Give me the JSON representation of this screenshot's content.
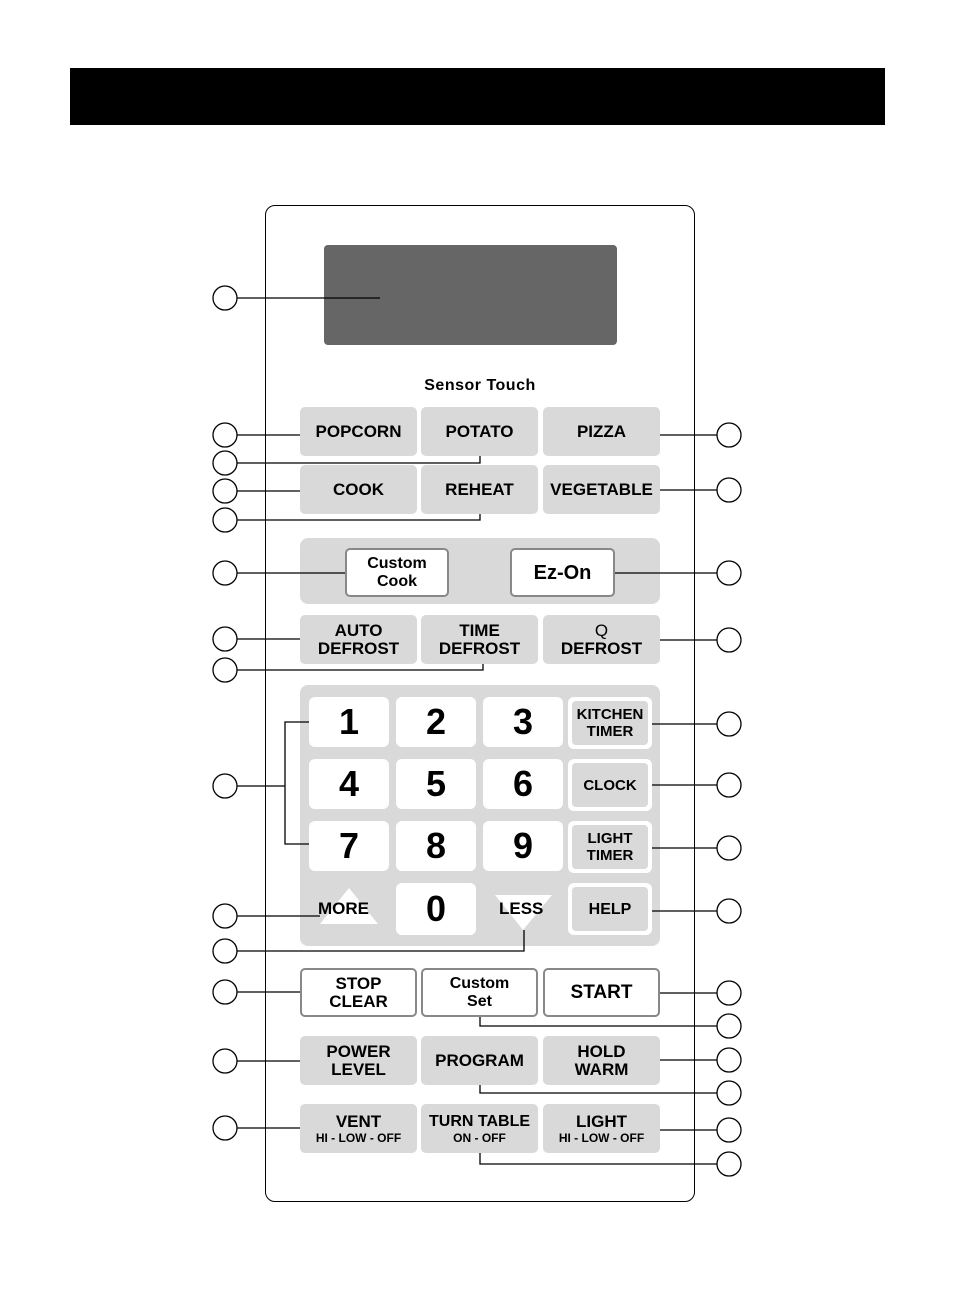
{
  "panel": {
    "sensor_label": "Sensor Touch"
  },
  "buttons": {
    "popcorn": "POPCORN",
    "potato": "POTATO",
    "pizza": "PIZZA",
    "cook": "COOK",
    "reheat": "REHEAT",
    "vegetable": "VEGETABLE",
    "custom_cook": [
      "Custom",
      "Cook"
    ],
    "ez_on": "Ez-On",
    "auto_defrost": [
      "AUTO",
      "DEFROST"
    ],
    "time_defrost": [
      "TIME",
      "DEFROST"
    ],
    "q_defrost": [
      "Q",
      "DEFROST"
    ],
    "digits": [
      "1",
      "2",
      "3",
      "4",
      "5",
      "6",
      "7",
      "8",
      "9",
      "0"
    ],
    "kitchen_timer": [
      "KITCHEN",
      "TIMER"
    ],
    "clock": "CLOCK",
    "light_timer": [
      "LIGHT",
      "TIMER"
    ],
    "help": "HELP",
    "more": "MORE",
    "less": "LESS",
    "stop_clear": [
      "STOP",
      "CLEAR"
    ],
    "custom_set": [
      "Custom",
      "Set"
    ],
    "start": "START",
    "power_level": [
      "POWER",
      "LEVEL"
    ],
    "program": "PROGRAM",
    "hold_warm": [
      "HOLD",
      "WARM"
    ],
    "vent": [
      "VENT",
      "HI - LOW - OFF"
    ],
    "turn_table": [
      "TURN TABLE",
      "ON - OFF"
    ],
    "light": [
      "LIGHT",
      "HI - LOW - OFF"
    ]
  },
  "colors": {
    "display": "#666666",
    "button": "#d9d9d9",
    "border": "#888888"
  }
}
